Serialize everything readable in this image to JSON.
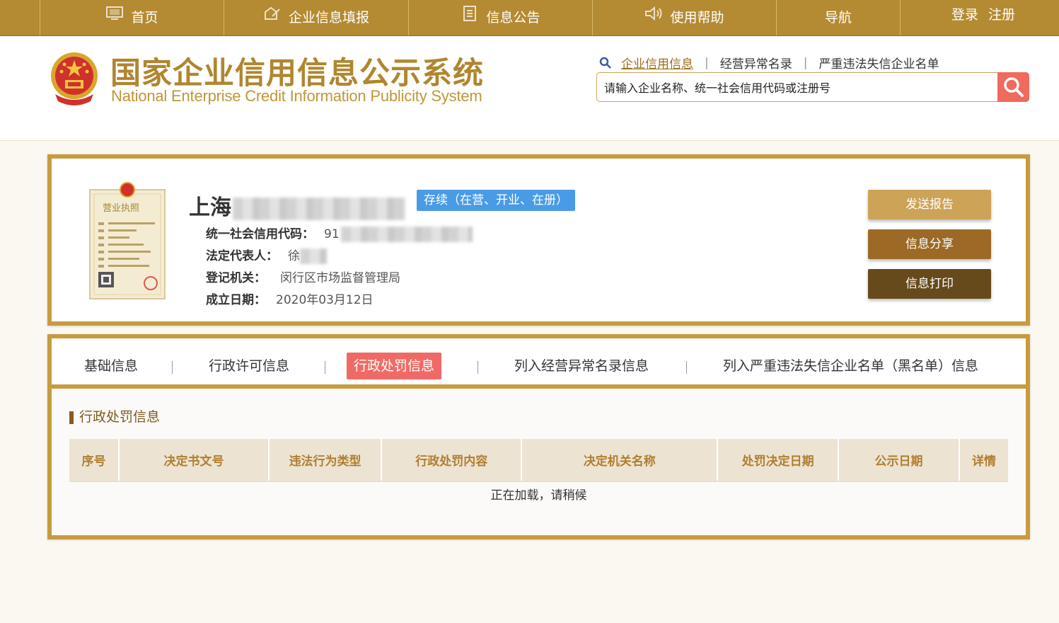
{
  "topnav": {
    "items": [
      {
        "label": "首页",
        "icon": "monitor-icon"
      },
      {
        "label": "企业信息填报",
        "icon": "edit-icon"
      },
      {
        "label": "信息公告",
        "icon": "document-icon"
      },
      {
        "label": "使用帮助",
        "icon": "speaker-icon"
      },
      {
        "label": "导航",
        "icon": ""
      }
    ],
    "login": "登录",
    "register": "注册"
  },
  "header": {
    "title_cn": "国家企业信用信息公示系统",
    "title_en": "National Enterprise Credit Information Publicity System",
    "search_tabs": [
      "企业信用信息",
      "经营异常名录",
      "严重违法失信企业名单"
    ],
    "search_placeholder": "请输入企业名称、统一社会信用代码或注册号"
  },
  "company": {
    "name_prefix": "上海",
    "status": "存续（在营、开业、在册）",
    "credit_code_label": "统一社会信用代码：",
    "credit_code_value": "91",
    "legal_rep_label": "法定代表人：",
    "legal_rep_value": "徐",
    "authority_label": "登记机关：",
    "authority_value": "闵行区市场监督管理局",
    "founded_label": "成立日期：",
    "founded_value": "2020年03月12日",
    "license_title": "营业执照"
  },
  "actions": {
    "send_report": "发送报告",
    "share": "信息分享",
    "print": "信息打印"
  },
  "tabs": [
    "基础信息",
    "行政许可信息",
    "行政处罚信息",
    "列入经营异常名录信息",
    "列入严重违法失信企业名单（黑名单）信息"
  ],
  "section": {
    "title": "行政处罚信息",
    "columns": [
      "序号",
      "决定书文号",
      "违法行为类型",
      "行政处罚内容",
      "决定机关名称",
      "处罚决定日期",
      "公示日期",
      "详情"
    ],
    "loading": "正在加载，请稍候"
  },
  "colors": {
    "brand_gold": "#b48a32",
    "frame_gold": "#c89b3f",
    "status_blue": "#4a9be6",
    "active_tab": "#f06a65",
    "btn_light": "#cda358",
    "btn_mid": "#9c6a26",
    "btn_dark": "#674a1c"
  }
}
